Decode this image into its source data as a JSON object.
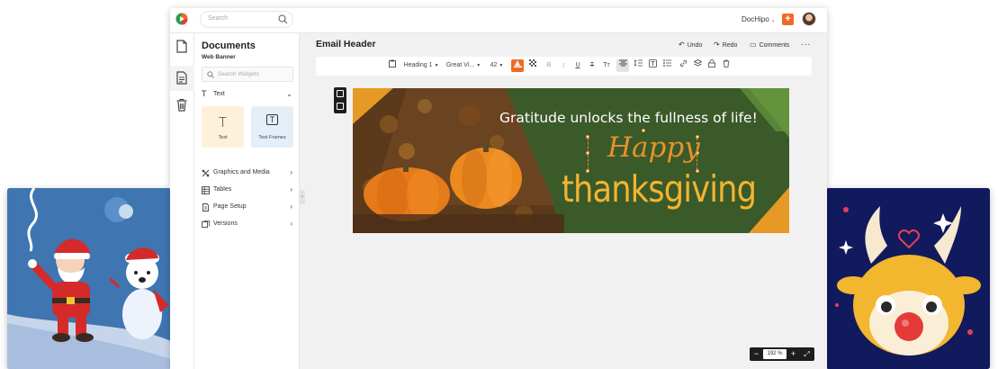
{
  "topbar": {
    "search_placeholder": "Search",
    "brand": "DocHipo",
    "add_label": "+"
  },
  "panel": {
    "title": "Documents",
    "subtitle": "Web Banner",
    "search_placeholder": "Search Widgets",
    "text_section": "Text",
    "tiles": [
      {
        "label": "Text",
        "glyph": "T"
      },
      {
        "label": "Text Frames",
        "glyph": "T"
      }
    ],
    "sections": [
      {
        "label": "Graphics and Media"
      },
      {
        "label": "Tables"
      },
      {
        "label": "Page Setup"
      },
      {
        "label": "Versions"
      }
    ]
  },
  "editor": {
    "doc_title": "Email Header",
    "undo": "Undo",
    "redo": "Redo",
    "comments": "Comments",
    "more": "...",
    "toolbar": {
      "style": "Heading 1",
      "font": "Great Vi...",
      "size": "42",
      "bold": "B",
      "italic": "I",
      "underline": "U",
      "strike": "T",
      "case": "Tт"
    }
  },
  "banner": {
    "line1": "Gratitude unlocks the fullness of life!",
    "happy": "Happy",
    "thanks": "thanksgiving"
  },
  "zoom": {
    "value": "192 %",
    "minus": "−",
    "plus": "+"
  },
  "colors": {
    "accent": "#f06a25",
    "banner_green": "#3b5a29",
    "banner_orange": "#e6912b",
    "banner_yellow": "#f3b52f",
    "left_card": "#3f75b0",
    "right_card": "#121a5e"
  }
}
